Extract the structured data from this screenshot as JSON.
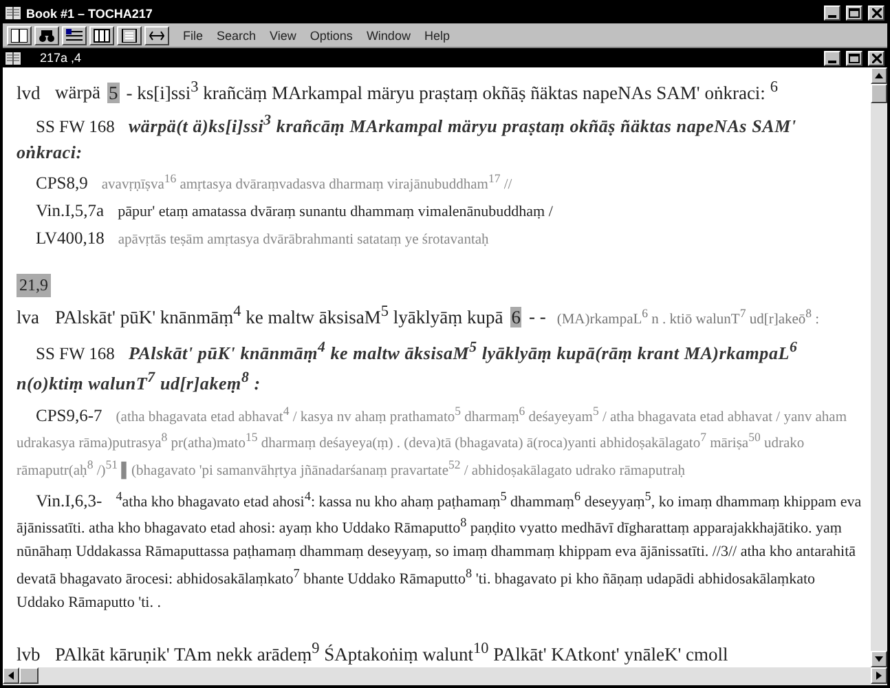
{
  "window": {
    "title": "Book #1 – TOCHA217"
  },
  "menu": [
    "File",
    "Search",
    "View",
    "Options",
    "Window",
    "Help"
  ],
  "document": {
    "title": "217a ,4"
  },
  "entries": [
    {
      "kind": "verse",
      "label": "lvd",
      "text": "wärpä",
      "marker": "5",
      "rest": "- ks[i]ssi$^{3}$ krañcäṃ MArkampal märyu praṣtaṃ okñāṣ ñäktas napeNAs SAM' oṅkraci: $^{6}$"
    },
    {
      "kind": "reconstruction",
      "ref": "SS FW 168",
      "text": "wärpä(t ä)ks[i]ssi$^{3}$ krañcāṃ MArkampal märyu praṣtaṃ okñāṣ ñäktas napeNAs SAM' oṅkraci:"
    },
    {
      "kind": "sanskrit",
      "ref": "CPS8,9",
      "text": "avavṛṇīṣva$^{16}$ amṛtasya dvāraṃvadasva dharmaṃ virajānubuddham$^{17}$ //"
    },
    {
      "kind": "pali",
      "ref": "Vin.I,5,7a",
      "text": "pāpur' etaṃ amatassa dvāraṃ sunantu dhammaṃ vimalenānubuddhaṃ /"
    },
    {
      "kind": "sanskrit",
      "ref": "LV400,18",
      "text": "apāvṛtās teṣām amṛtasya dvārābrahmanti satataṃ ye śrotavantaḥ"
    },
    {
      "kind": "heading",
      "text": "21,9"
    },
    {
      "kind": "verse",
      "label": "lva",
      "text": "PAlskāt' pūK' knānmāṃ$^{4}$ ke maltw āksisaM$^{5}$ lyāklyāṃ kupā",
      "marker": "6",
      "rest": "- -",
      "note": "(MA)rkampaL$^{6}$ n . ktiō walunT$^{7}$ ud[r]akeō$^{8}$ :"
    },
    {
      "kind": "reconstruction",
      "ref": "SS FW 168",
      "text": "PAlskāt' pūK' knānmāṃ$^{4}$ ke maltw āksisaM$^{5}$ lyāklyāṃ kupā(rāṃ krant MA)rkampaL$^{6}$ n(o)ktiṃ walunT$^{7}$ ud[r]akeṃ$^{8}$ :"
    },
    {
      "kind": "sanskrit",
      "ref": "CPS9,6-7",
      "text": "(atha bhagavata etad abhavat$^{4}$ / kasya nv ahaṃ prathamato$^{5}$ dharmaṃ$^{6}$ deśayeyam$^{5}$ / atha bhagavata etad abhavat / yanv aham udrakasya rāma)putrasya$^{8}$ pr(atha)mato$^{15}$ dharmaṃ deśayeya(ṃ) . (deva)tā (bhagavata) ā(roca)yanti abhidoṣakālagato$^{7}$ māriṣa$^{50}$ udrako rāmaputr(aḥ$^{8}$ /)$^{51}$ ▌(bhagavato 'pi samanvāhṛtya jñānadarśanaṃ pravartate$^{52}$ / abhidoṣakālagato udrako rāmaputraḥ"
    },
    {
      "kind": "pali",
      "ref": "Vin.I,6,3-",
      "text": "$^{4}$atha kho bhagavato etad ahosi$^{4}$: kassa nu kho ahaṃ paṭhamaṃ$^{5}$ dhammaṃ$^{6}$ deseyyaṃ$^{5}$, ko imaṃ dhammaṃ khippam eva ājānissatīti. atha kho bhagavato etad ahosi: ayaṃ kho Uddako Rāmaputto$^{8}$ paṇḍito vyatto medhāvī dīgharattaṃ apparajakkhajātiko. yaṃ nūnāhaṃ Uddakassa Rāmaputtassa paṭhamaṃ dhammaṃ deseyyaṃ, so imaṃ dhammaṃ khippam eva ājānissatīti. //3// atha kho antarahitā devatā bhagavato ārocesi: abhidosakālaṃkato$^{7}$ bhante Uddako Rāmaputto$^{8}$ 'ti. bhagavato pi kho ñāṇaṃ udapādi abhidosakālaṃkato Uddako Rāmaputto 'ti. ."
    },
    {
      "kind": "verse",
      "label": "lvb",
      "text": "PAlkāt kāruṇik' TAm nekk arādeṃ$^{9}$ ŚAptakoṅiṃ walunt$^{10}$ PAlkāt' KAtkont' ynāleK' cmoll"
    }
  ]
}
